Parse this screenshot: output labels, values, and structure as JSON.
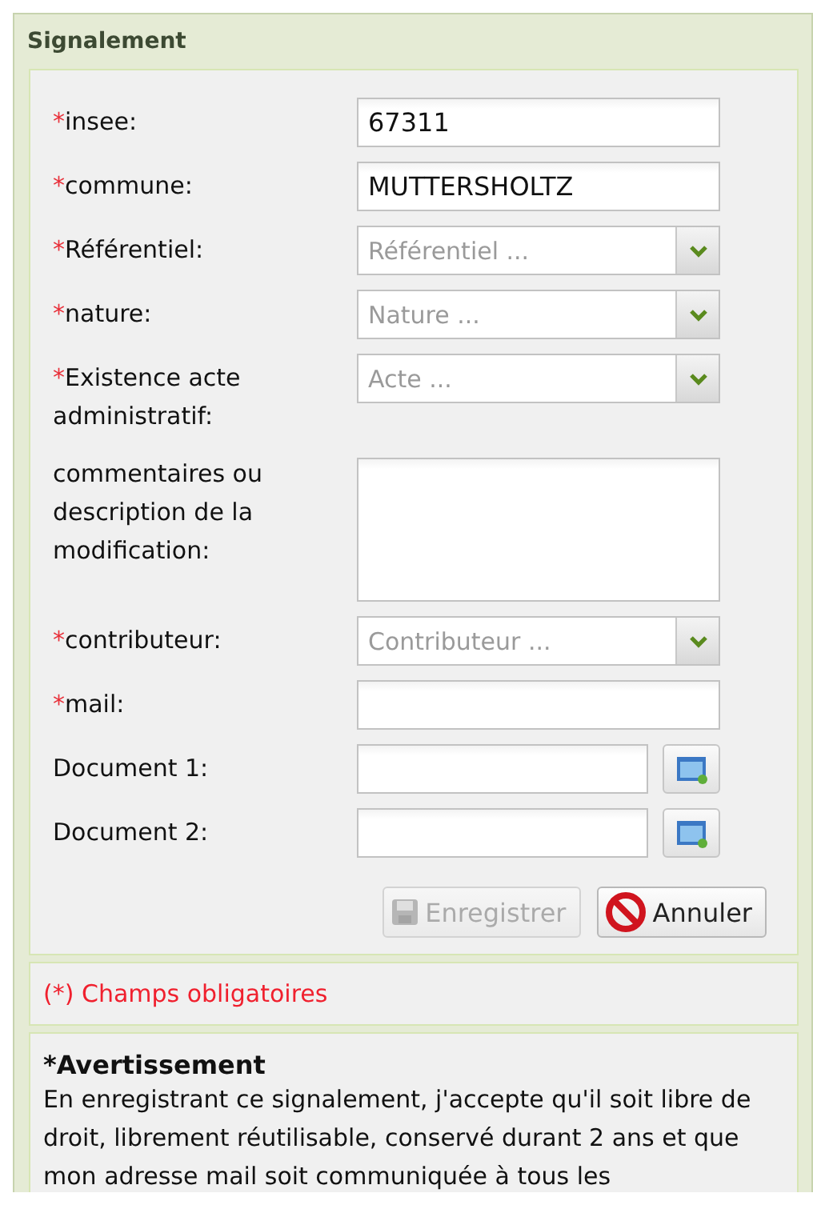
{
  "panel": {
    "title": "Signalement"
  },
  "fields": [
    {
      "kind": "text",
      "required_mark": "*",
      "label": "insee:",
      "value": "67311"
    },
    {
      "kind": "text",
      "required_mark": "*",
      "label": "commune:",
      "value": "MUTTERSHOLTZ"
    },
    {
      "kind": "select",
      "required_mark": "*",
      "label": "Référentiel:",
      "placeholder": "Référentiel ..."
    },
    {
      "kind": "select",
      "required_mark": "*",
      "label": "nature:",
      "placeholder": "Nature ..."
    },
    {
      "kind": "select",
      "required_mark": "*",
      "label": "Existence acte administratif:",
      "placeholder": "Acte ..."
    },
    {
      "kind": "textarea",
      "label": "commentaires ou description de la modification:"
    },
    {
      "kind": "select",
      "required_mark": "*",
      "label": "contributeur:",
      "placeholder": "Contributeur ..."
    },
    {
      "kind": "text",
      "required_mark": "*",
      "label": "mail:"
    },
    {
      "kind": "file",
      "label": "Document 1:"
    },
    {
      "kind": "file",
      "label": "Document 2:"
    }
  ],
  "buttons": [
    {
      "kind": "save",
      "label": "Enregistrer",
      "disabled": true
    },
    {
      "kind": "cancel",
      "label": "Annuler",
      "disabled": false
    }
  ],
  "required_note": "(*) Champs obligatoires",
  "warning": {
    "title": "*Avertissement",
    "text": "En enregistrant ce signalement, j'accepte qu'il soit libre de droit, librement réutilisable, conservé durant 2 ans et que mon adresse mail soit communiquée à tous les"
  }
}
